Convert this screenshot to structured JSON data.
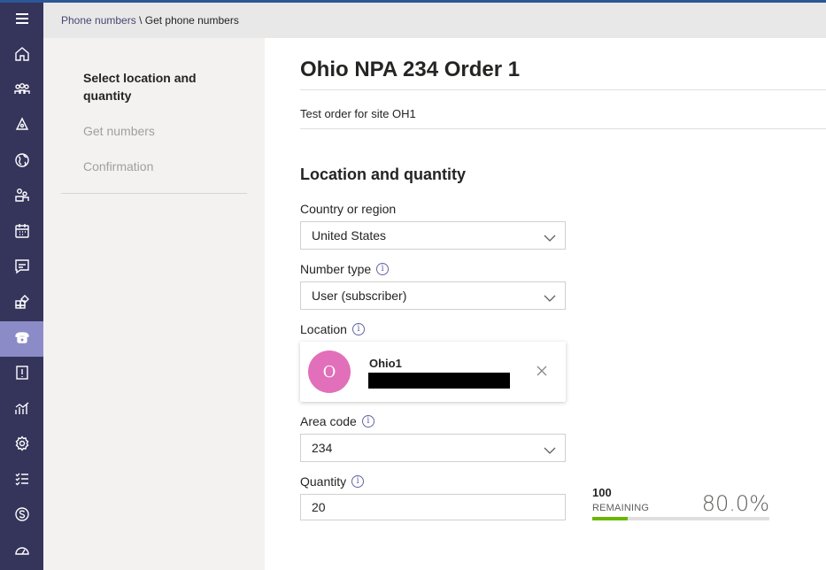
{
  "breadcrumb": {
    "parent": "Phone numbers",
    "separator": " \\ ",
    "current": "Get phone numbers"
  },
  "wizard": {
    "steps": [
      {
        "label": "Select location and quantity",
        "state": "current"
      },
      {
        "label": "Get numbers",
        "state": "pending"
      },
      {
        "label": "Confirmation",
        "state": "pending"
      }
    ]
  },
  "page": {
    "title": "Ohio NPA 234 Order 1",
    "description": "Test order for site OH1",
    "section_title": "Location and quantity"
  },
  "form": {
    "country": {
      "label": "Country or region",
      "value": "United States"
    },
    "number_type": {
      "label": "Number type",
      "value": "User (subscriber)"
    },
    "location": {
      "label": "Location",
      "name": "Ohio1",
      "avatar_initial": "O"
    },
    "area_code": {
      "label": "Area code",
      "value": "234"
    },
    "quantity": {
      "label": "Quantity",
      "value": "20"
    }
  },
  "remaining": {
    "count": "100",
    "label": "REMAINING",
    "percent_text": "80.0%",
    "bar_fill_fraction": 0.2
  },
  "rail": {
    "icons": [
      "menu-icon",
      "home-icon",
      "teams-icon",
      "devices-icon",
      "globe-icon",
      "users-icon",
      "meetings-icon",
      "messaging-icon",
      "apps-icon",
      "voice-icon",
      "policy-packages-icon",
      "analytics-icon",
      "settings-icon",
      "planning-icon",
      "skype-icon",
      "call-quality-icon"
    ],
    "active": "voice-icon"
  },
  "colors": {
    "rail_bg": "#35345b",
    "rail_active": "#8b8cc7",
    "avatar": "#e26fb9",
    "progress": "#6bb700",
    "accent": "#6264a7"
  }
}
